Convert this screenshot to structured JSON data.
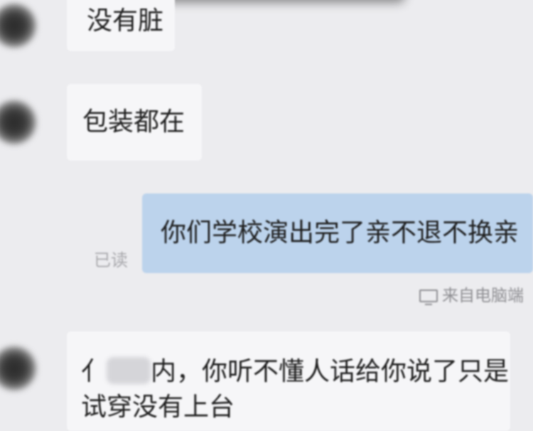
{
  "messages": [
    {
      "direction": "incoming",
      "text": "没有脏"
    },
    {
      "direction": "incoming",
      "text": "包装都在"
    },
    {
      "direction": "outgoing",
      "text": "你们学校演出完了亲不退不换亲",
      "status": "已读"
    },
    {
      "direction": "incoming",
      "line1_prefix": "亻",
      "line1_suffix": "内，你听不懂人话给你说了只是",
      "line2": "试穿没有上台"
    }
  ],
  "footer": {
    "source_text": "来自电脑端",
    "icon": "monitor-icon"
  },
  "colors": {
    "background": "#ececef",
    "incoming_bubble": "#f6f6f8",
    "outgoing_bubble": "#bcd3ec",
    "text": "#1f1f1f",
    "meta_text": "#8f8f93"
  }
}
